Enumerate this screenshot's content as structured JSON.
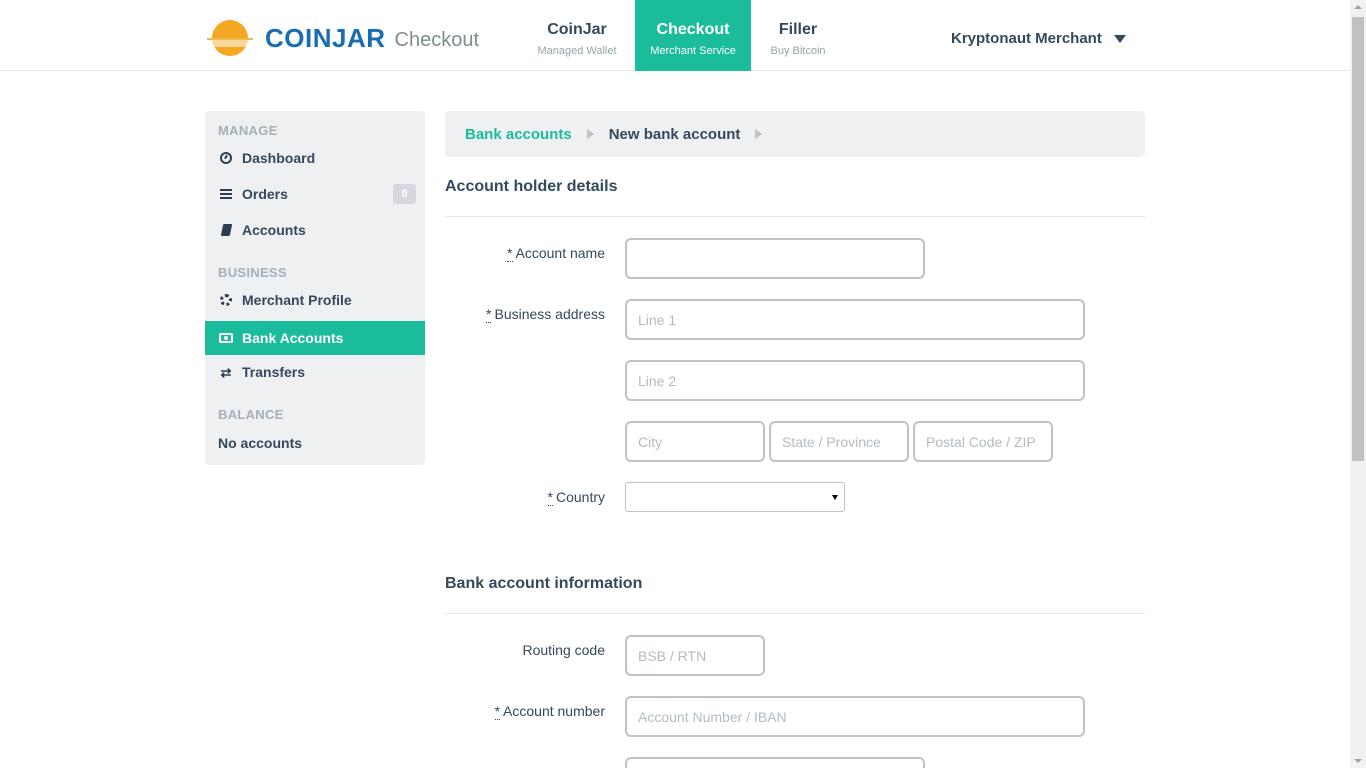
{
  "brand": {
    "name": "COINJAR",
    "product": "Checkout"
  },
  "topnav": [
    {
      "title": "CoinJar",
      "subtitle": "Managed Wallet"
    },
    {
      "title": "Checkout",
      "subtitle": "Merchant Service"
    },
    {
      "title": "Filler",
      "subtitle": "Buy Bitcoin"
    }
  ],
  "user": {
    "name": "Kryptonaut Merchant"
  },
  "sidebar": {
    "manage_heading": "MANAGE",
    "business_heading": "BUSINESS",
    "balance_heading": "BALANCE",
    "items": [
      {
        "label": "Dashboard",
        "icon": "dashboard-icon"
      },
      {
        "label": "Orders",
        "icon": "list-icon",
        "badge": "0"
      },
      {
        "label": "Accounts",
        "icon": "book-icon"
      },
      {
        "label": "Merchant Profile",
        "icon": "gear-icon"
      },
      {
        "label": "Bank Accounts",
        "icon": "money-icon"
      },
      {
        "label": "Transfers",
        "icon": "exchange-icon"
      }
    ],
    "balance_value": "No accounts"
  },
  "breadcrumb": {
    "parent": "Bank accounts",
    "current": "New bank account"
  },
  "holder": {
    "title": "Account holder details",
    "account_name_label": "Account name",
    "business_address_label": "Business address",
    "line1_placeholder": "Line 1",
    "line2_placeholder": "Line 2",
    "city_placeholder": "City",
    "state_placeholder": "State / Province",
    "postal_placeholder": "Postal Code / ZIP",
    "country_label": "Country"
  },
  "bank": {
    "title": "Bank account information",
    "routing_label": "Routing code",
    "routing_placeholder": "BSB / RTN",
    "account_number_label": "Account number",
    "account_number_placeholder": "Account Number / IBAN"
  },
  "required_marker": "*",
  "colors": {
    "accent": "#1abc9c",
    "brand_blue": "#1a6db3",
    "sun": "#f5a623",
    "text": "#34495e"
  }
}
